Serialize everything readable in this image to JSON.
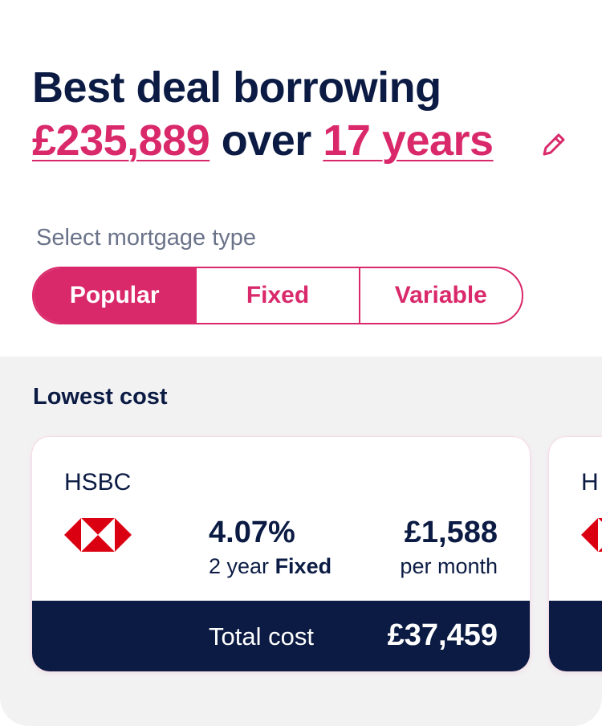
{
  "header": {
    "title_line1": "Best deal borrowing",
    "amount": "£235,889",
    "connector": "over",
    "term": "17 years",
    "edit_icon": "pencil-icon"
  },
  "mortgage_type": {
    "label": "Select mortgage type",
    "options": [
      "Popular",
      "Fixed",
      "Variable"
    ],
    "selected": "Popular"
  },
  "results": {
    "section_title": "Lowest cost",
    "cards": [
      {
        "lender": "HSBC",
        "logo_icon": "hsbc-logo-icon",
        "rate": "4.07%",
        "term_years": "2 year",
        "product_type": "Fixed",
        "monthly_payment": "£1,588",
        "per_month_label": "per month",
        "total_cost_label": "Total cost",
        "total_cost": "£37,459"
      },
      {
        "lender": "H",
        "logo_icon": "hsbc-logo-icon"
      }
    ]
  },
  "colors": {
    "accent": "#d9296a",
    "navy": "#0b1b43",
    "muted_text": "#6a7389",
    "panel_bg": "#f2f2f3",
    "logo_red": "#db0011"
  }
}
